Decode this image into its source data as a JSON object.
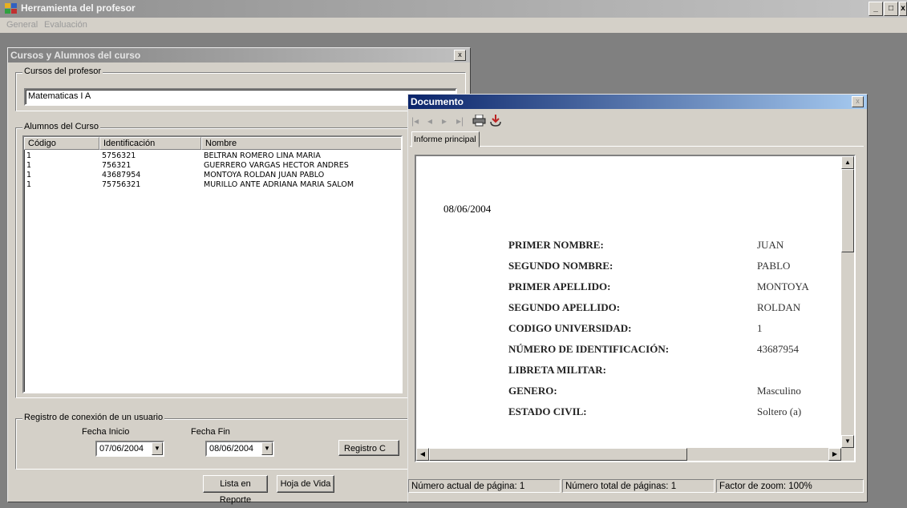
{
  "app": {
    "title": "Herramienta del profesor",
    "window_controls": [
      "_",
      "□",
      "x"
    ]
  },
  "menu": [
    "General",
    "Evaluación"
  ],
  "cursos_window": {
    "title": "Cursos y Alumnos del curso",
    "close": "x",
    "cursos_group": "Cursos del profesor",
    "curso_value": "Matematicas I A",
    "alumnos_group": "Alumnos del Curso",
    "columns": [
      "Código",
      "Identificación",
      "Nombre"
    ],
    "rows": [
      {
        "codigo": "1",
        "id": "5756321",
        "nombre": "BELTRAN  ROMERO LINA MARIA"
      },
      {
        "codigo": "1",
        "id": "756321",
        "nombre": "GUERRERO VARGAS HECTOR ANDRES"
      },
      {
        "codigo": "1",
        "id": "43687954",
        "nombre": "MONTOYA ROLDAN JUAN PABLO"
      },
      {
        "codigo": "1",
        "id": "75756321",
        "nombre": "MURILLO ANTE ADRIANA MARIA SALOM"
      }
    ],
    "registro_group": "Registro de conexión de un usuario",
    "fecha_inicio_label": "Fecha Inicio",
    "fecha_fin_label": "Fecha Fin",
    "fecha_inicio": "07/06/2004",
    "fecha_fin": "08/06/2004",
    "registro_button": "Registro C",
    "lista_button": "Lista en Reporte",
    "hoja_button": "Hoja de Vida"
  },
  "documento": {
    "title": "Documento",
    "close": "x",
    "toolbar": {
      "first": "|◂",
      "prev": "◂",
      "next": "▸",
      "last": "▸|",
      "print_icon": "printer-icon",
      "export_icon": "export-icon"
    },
    "tab": "Informe principal",
    "report": {
      "date": "08/06/2004",
      "fields": [
        {
          "label": "PRIMER NOMBRE:",
          "value": "JUAN"
        },
        {
          "label": "SEGUNDO NOMBRE:",
          "value": "PABLO"
        },
        {
          "label": "PRIMER APELLIDO:",
          "value": "MONTOYA"
        },
        {
          "label": "SEGUNDO APELLIDO:",
          "value": "ROLDAN"
        },
        {
          "label": "CODIGO UNIVERSIDAD:",
          "value": "1"
        },
        {
          "label": "NÚMERO DE IDENTIFICACIÓN:",
          "value": "43687954"
        },
        {
          "label": "LIBRETA MILITAR:",
          "value": ""
        },
        {
          "label": "GENERO:",
          "value": "Masculino"
        },
        {
          "label": "ESTADO CIVIL:",
          "value": "Soltero (a)"
        }
      ]
    },
    "status": {
      "current_page": "Número actual de página: 1",
      "total_pages": "Número total de páginas: 1",
      "zoom": "Factor de zoom: 100%"
    }
  }
}
